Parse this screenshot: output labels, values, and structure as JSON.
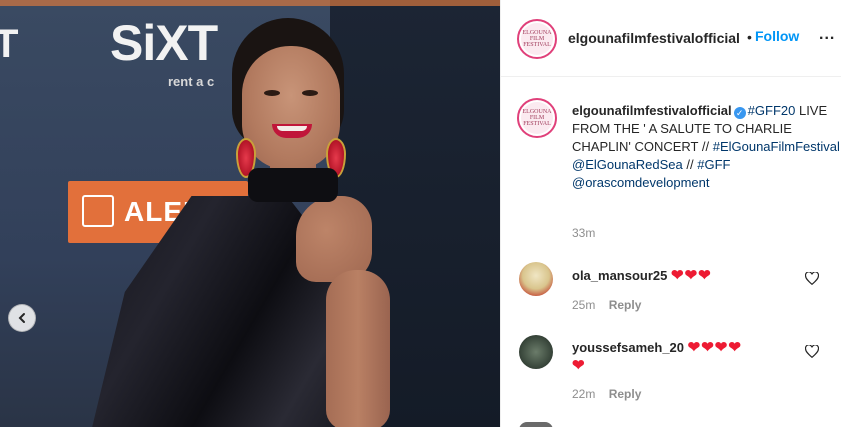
{
  "photo": {
    "sponsors": [
      "T",
      "SiXT",
      "rent a c",
      "ALEF"
    ]
  },
  "header": {
    "avatar_text": "ELGOUNA FILM FESTIVAL",
    "username": "elgounafilmfestivalofficial",
    "separator": "•",
    "follow_label": "Follow",
    "more_label": "..."
  },
  "caption": {
    "avatar_text": "ELGOUNA FILM FESTIVAL",
    "username": "elgounafilmfestivalofficial",
    "hashtag1": "#GFF20",
    "line1": "LIVE FROM THE ' A SALUTE TO CHARLIE CHAPLIN' CONCERT //",
    "hashtag2": "#ElGounaFilmFestival",
    "mention1": "@ElGounaRedSea",
    "sep": " // ",
    "hashtag3": "#GFF",
    "mention2": "@orascomdevelopment",
    "time": "33m"
  },
  "comments": [
    {
      "username": "ola_mansour25",
      "hearts": "❤❤❤",
      "time": "25m",
      "reply": "Reply"
    },
    {
      "username": "youssefsameh_20",
      "hearts": "❤❤❤❤",
      "hearts2": "❤",
      "time": "22m",
      "reply": "Reply"
    }
  ],
  "colors": {
    "accent": "#0095f6",
    "heart": "#ed1b33",
    "story_ring": "#e0407a"
  }
}
